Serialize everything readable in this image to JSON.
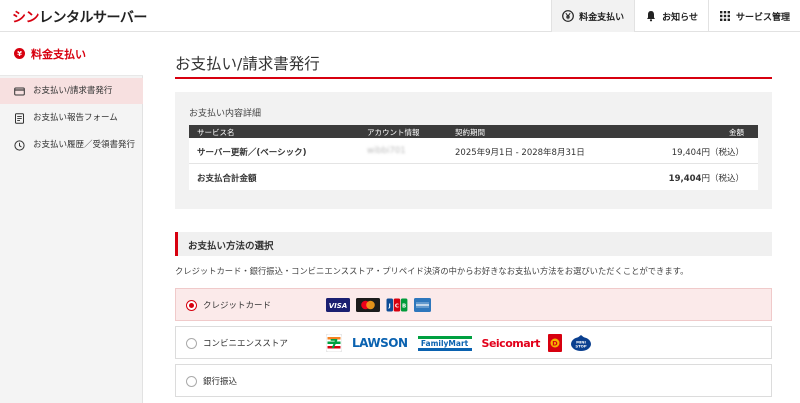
{
  "header": {
    "logo_red": "シン",
    "logo_rest": "レンタルサーバー",
    "nav": [
      {
        "label": "料金支払い",
        "icon": "yen-circle-icon",
        "active": true
      },
      {
        "label": "お知らせ",
        "icon": "bell-icon",
        "active": false
      },
      {
        "label": "サービス管理",
        "icon": "grid-icon",
        "active": false
      }
    ]
  },
  "sidebar": {
    "title": "料金支払い",
    "items": [
      {
        "label": "お支払い/請求書発行",
        "icon": "card-icon"
      },
      {
        "label": "お支払い報告フォーム",
        "icon": "form-icon"
      },
      {
        "label": "お支払い履歴／受領書発行",
        "icon": "history-icon"
      }
    ]
  },
  "main": {
    "title": "お支払い/請求書発行",
    "detail": {
      "heading": "お支払い内容詳細",
      "columns": [
        "サービス名",
        "アカウント情報",
        "契約期間",
        "金額"
      ],
      "row": {
        "service": "サーバー更新／(ベーシック)",
        "account": "wibbi701",
        "period": "2025年9月1日 - 2028年8月31日",
        "amount": "19,404円（税込）"
      },
      "total_label": "お支払合計金額",
      "total_amount": "19,404",
      "total_suffix": "円（税込）"
    },
    "method": {
      "heading": "お支払い方法の選択",
      "description": "クレジットカード・銀行振込・コンビニエンスストア・プリペイド決済の中からお好きなお支払い方法をお選びいただくことができます。",
      "options": [
        {
          "label": "クレジットカード",
          "selected": true,
          "logos": [
            "VISA",
            "Mastercard",
            "JCB",
            "AMERICAN EXPRESS"
          ]
        },
        {
          "label": "コンビニエンスストア",
          "selected": false,
          "logos": [
            "7-Eleven",
            "LAWSON",
            "FamilyMart",
            "Seicomart",
            "Daily Yamazaki",
            "MINISTOP"
          ]
        },
        {
          "label": "銀行振込",
          "selected": false,
          "logos": []
        }
      ]
    }
  },
  "colors": {
    "accent": "#d7000f",
    "sidebar_bg": "#f4f4f4",
    "table_head": "#3b3b3b"
  }
}
